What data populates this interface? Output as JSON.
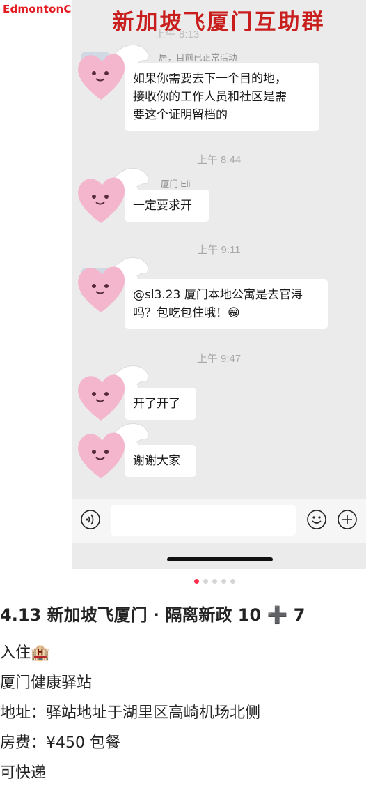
{
  "watermark": "EdmontonChina.NET",
  "chat": {
    "title": "新加坡飞厦门互助群",
    "partial_top_time": "上午 8:13",
    "messages": [
      {
        "sender": "居，目前已正常活动",
        "text": "如果你需要去下一个目的地，\n接收你的工作人员和社区是需\n要这个证明留档的"
      },
      {
        "sender": "厦门 Eli",
        "text": "一定要求开"
      },
      {
        "sender": "",
        "text": "@sl3.23 厦门本地公寓是去官浔\n吗？包吃包住哦！😁"
      },
      {
        "sender": "",
        "text": "开了开了"
      },
      {
        "sender": "",
        "text": "谢谢大家"
      }
    ],
    "times": [
      "上午 8:44",
      "上午 9:11",
      "上午 9:47"
    ],
    "icons": [
      "voice-icon",
      "emoji-icon",
      "plus-icon"
    ]
  },
  "colors": {
    "watermark": "#e31b23",
    "title": "#c81e1e",
    "chat_bg": "#ebebeb",
    "active_dot": "#ff2d4b"
  },
  "carousel": {
    "total": 5,
    "active": 0
  },
  "post": {
    "title": "4.13 新加坡飞厦门 · 隔离新政 10 ➕ 7",
    "lines": [
      "入住🏨",
      "厦门健康驿站",
      "地址：驿站地址于湖里区高崎机场北侧",
      "房费：¥450 包餐",
      "可快递"
    ]
  }
}
